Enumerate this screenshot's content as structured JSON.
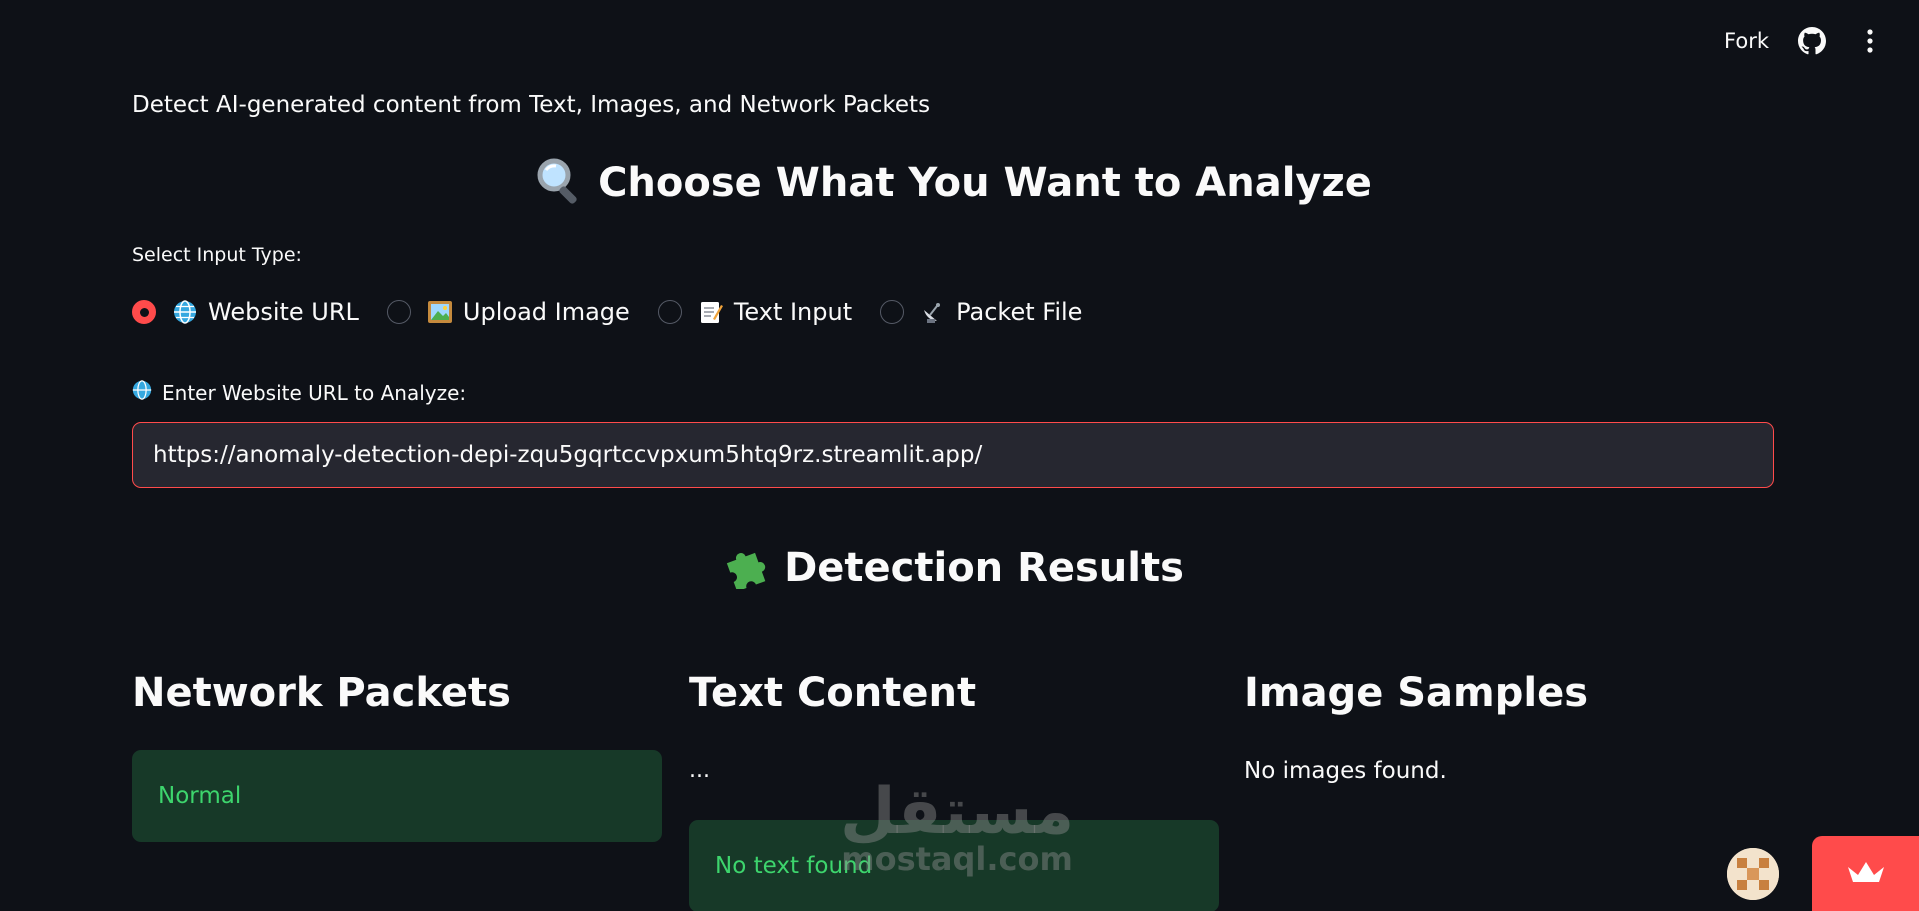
{
  "header": {
    "fork_label": "Fork",
    "icons": [
      "github-icon",
      "more-vertical-icon"
    ]
  },
  "subtitle": "Detect AI-generated content from Text, Images, and Network Packets",
  "analyze_section": {
    "icon": "magnifier-icon",
    "title": "Choose What You Want to Analyze"
  },
  "input_type": {
    "label": "Select Input Type:",
    "selected": "Website URL",
    "options": [
      {
        "label": "Website URL",
        "icon": "globe-icon",
        "checked": true
      },
      {
        "label": "Upload Image",
        "icon": "framed-picture-icon",
        "checked": false
      },
      {
        "label": "Text Input",
        "icon": "memo-icon",
        "checked": false
      },
      {
        "label": "Packet File",
        "icon": "satellite-antenna-icon",
        "checked": false
      }
    ]
  },
  "url_field": {
    "icon": "globe-icon",
    "label": "Enter Website URL to Analyze:",
    "value": "https://anomaly-detection-depi-zqu5gqrtccvpxum5htq9rz.streamlit.app/"
  },
  "results_section": {
    "icon": "puzzle-piece-icon",
    "title": "Detection Results"
  },
  "columns": {
    "network": {
      "title": "Network Packets",
      "status": "Normal"
    },
    "text": {
      "title": "Text Content",
      "preview": "...",
      "status": "No text found"
    },
    "images": {
      "title": "Image Samples",
      "message": "No images found."
    }
  },
  "watermark": {
    "arabic": "مستقل",
    "latin": "mostaql.com"
  },
  "colors": {
    "background": "#0e1117",
    "accent": "#ff4b4b",
    "success_bg": "#173928",
    "success_text": "#3dd56d",
    "input_bg": "#262730"
  }
}
